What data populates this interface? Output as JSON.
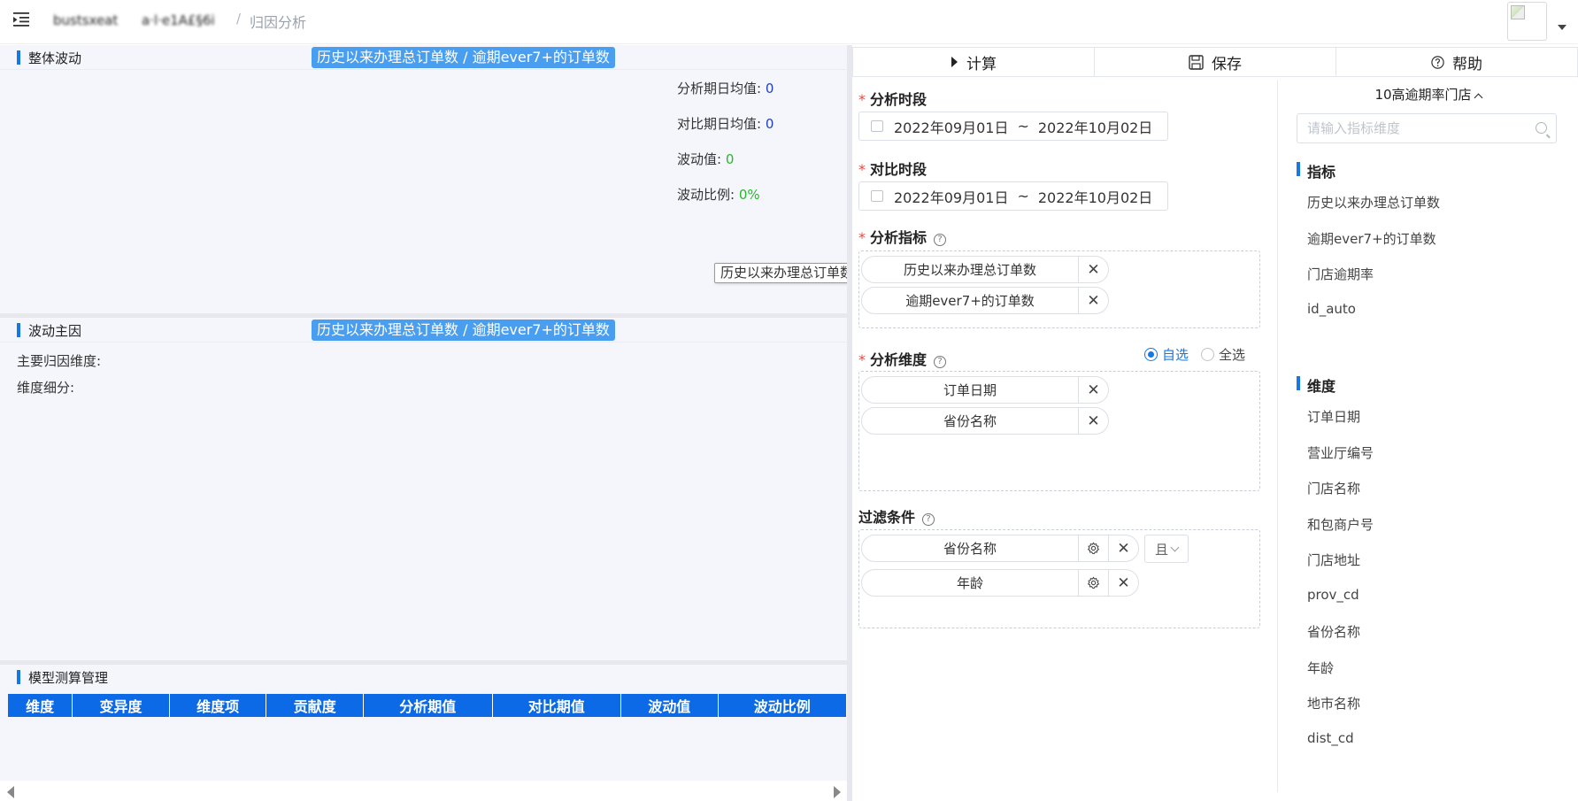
{
  "header": {
    "breadcrumb_blurred_1": "bustsxeat",
    "breadcrumb_blurred_2": "a·l·e1A£§6i",
    "breadcrumb_separator": "/",
    "breadcrumb_current": "归因分析"
  },
  "overall": {
    "title": "整体波动",
    "metric_pill": "历史以来办理总订单数 / 逾期ever7+的订单数",
    "analysis_avg_label": "分析期日均值:",
    "analysis_avg_value": "0",
    "compare_avg_label": "对比期日均值:",
    "compare_avg_value": "0",
    "fluct_value_label": "波动值:",
    "fluct_value": "0",
    "fluct_ratio_label": "波动比例:",
    "fluct_ratio": "0%"
  },
  "tooltip": "历史以来办理总订单数",
  "cause": {
    "title": "波动主因",
    "metric_pill": "历史以来办理总订单数 / 逾期ever7+的订单数",
    "main_dimension_label": "主要归因维度:",
    "dimension_detail_label": "维度细分:"
  },
  "model": {
    "title": "模型测算管理",
    "columns": [
      "维度",
      "变异度",
      "维度项",
      "贡献度",
      "分析期值",
      "对比期值",
      "波动值",
      "波动比例"
    ]
  },
  "toolbar": {
    "compute": "计算",
    "save": "保存",
    "help": "帮助"
  },
  "form": {
    "analysis_period_label": "分析时段",
    "analysis_start": "2022年09月01日",
    "analysis_end": "2022年10月02日",
    "compare_period_label": "对比时段",
    "compare_start": "2022年09月01日",
    "compare_end": "2022年10月02日",
    "date_tilde": "~",
    "metrics_label": "分析指标",
    "metrics": [
      "历史以来办理总订单数",
      "逾期ever7+的订单数"
    ],
    "dimensions_label": "分析维度",
    "radio_custom": "自选",
    "radio_all": "全选",
    "dimensions": [
      "订单日期",
      "省份名称"
    ],
    "filters_label": "过滤条件",
    "filters": [
      "省份名称",
      "年龄"
    ],
    "filter_logic": "且",
    "close_glyph": "✕"
  },
  "side": {
    "title": "10高逾期率门店",
    "search_placeholder": "请输入指标维度",
    "metrics_head": "指标",
    "metrics": [
      "历史以来办理总订单数",
      "逾期ever7+的订单数",
      "门店逾期率",
      "id_auto"
    ],
    "dims_head": "维度",
    "dims": [
      "订单日期",
      "营业厅编号",
      "门店名称",
      "和包商户号",
      "门店地址",
      "prov_cd",
      "省份名称",
      "年龄",
      "地市名称",
      "dist_cd"
    ]
  },
  "colors": {
    "accent": "#1677e6",
    "pill": "#4a9ef0",
    "table_header": "#0c6ae6",
    "value_blue": "#1f3fbf",
    "value_green": "#29b52c",
    "required": "#f0453a"
  }
}
